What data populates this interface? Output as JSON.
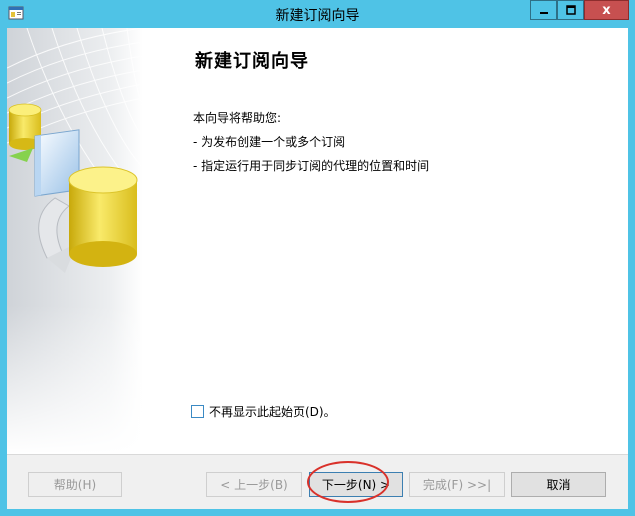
{
  "window": {
    "title": "新建订阅向导",
    "controls": {
      "minimize": "▁",
      "maximize": "☐",
      "close": "x"
    }
  },
  "content": {
    "heading": "新建订阅向导",
    "intro": "本向导将帮助您:",
    "bullets": [
      "- 为发布创建一个或多个订阅",
      "- 指定运行用于同步订阅的代理的位置和时间"
    ],
    "checkbox_label": "不再显示此起始页(D)。",
    "checkbox_checked": false
  },
  "buttons": {
    "help": "帮助(H)",
    "back": "< 上一步(B)",
    "next": "下一步(N) >",
    "finish": "完成(F) >>|",
    "cancel": "取消"
  },
  "colors": {
    "title_bar": "#4fc3e6",
    "close_button": "#c75050",
    "highlight": "#d9312a"
  },
  "icons": {
    "app": "wizard-app-icon",
    "side_art": "database-cylinders-illustration"
  }
}
